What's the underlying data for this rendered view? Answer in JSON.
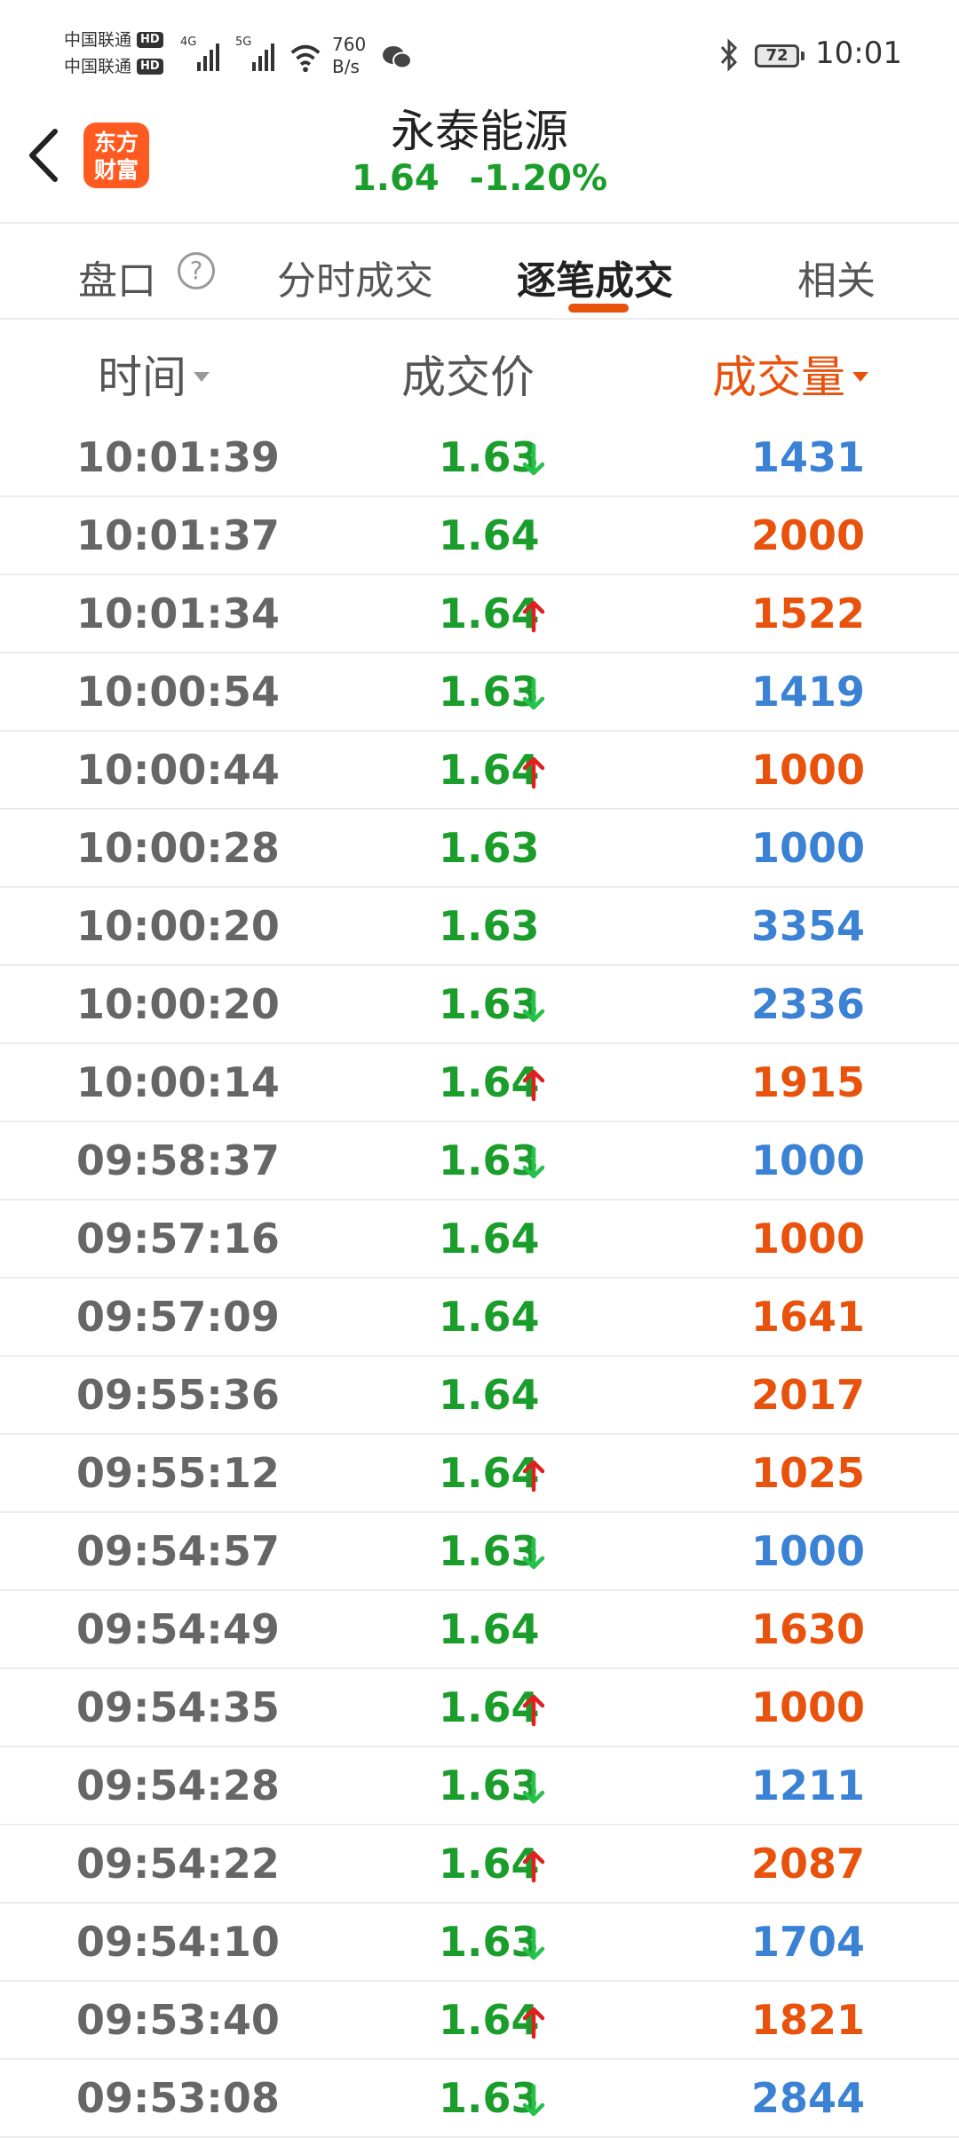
{
  "status_bar": {
    "carrier1": "中国联通",
    "carrier2": "中国联通",
    "hd_badge": "HD",
    "sig1": "4G",
    "sig2": "5G",
    "speed_value": "760",
    "speed_unit": "B/s",
    "battery": "72",
    "time": "10:01"
  },
  "header": {
    "app_logo_line1": "东方",
    "app_logo_line2": "财富",
    "title": "永泰能源",
    "price": "1.64",
    "change_pct": "-1.20%"
  },
  "tabs": [
    {
      "label": "盘口",
      "active": false
    },
    {
      "label": "分时成交",
      "active": false
    },
    {
      "label": "逐笔成交",
      "active": true
    },
    {
      "label": "相关",
      "active": false
    }
  ],
  "help_symbol": "?",
  "columns": {
    "time": "时间",
    "price": "成交价",
    "volume": "成交量",
    "sorted_by": "volume"
  },
  "colors": {
    "green": "#1a9d2b",
    "arrow_down": "#27c24c",
    "arrow_up": "#e02020",
    "orange": "#e8520c",
    "blue": "#3b82d4"
  },
  "trades": [
    {
      "time": "10:01:39",
      "price": "1.63",
      "dir": "down",
      "volume": "1431"
    },
    {
      "time": "10:01:37",
      "price": "1.64",
      "dir": "",
      "volume": "2000"
    },
    {
      "time": "10:01:34",
      "price": "1.64",
      "dir": "up",
      "volume": "1522"
    },
    {
      "time": "10:00:54",
      "price": "1.63",
      "dir": "down",
      "volume": "1419"
    },
    {
      "time": "10:00:44",
      "price": "1.64",
      "dir": "up",
      "volume": "1000"
    },
    {
      "time": "10:00:28",
      "price": "1.63",
      "dir": "",
      "volume": "1000"
    },
    {
      "time": "10:00:20",
      "price": "1.63",
      "dir": "",
      "volume": "3354"
    },
    {
      "time": "10:00:20",
      "price": "1.63",
      "dir": "down",
      "volume": "2336"
    },
    {
      "time": "10:00:14",
      "price": "1.64",
      "dir": "up",
      "volume": "1915"
    },
    {
      "time": "09:58:37",
      "price": "1.63",
      "dir": "down",
      "volume": "1000"
    },
    {
      "time": "09:57:16",
      "price": "1.64",
      "dir": "",
      "volume": "1000"
    },
    {
      "time": "09:57:09",
      "price": "1.64",
      "dir": "",
      "volume": "1641"
    },
    {
      "time": "09:55:36",
      "price": "1.64",
      "dir": "",
      "volume": "2017"
    },
    {
      "time": "09:55:12",
      "price": "1.64",
      "dir": "up",
      "volume": "1025"
    },
    {
      "time": "09:54:57",
      "price": "1.63",
      "dir": "down",
      "volume": "1000"
    },
    {
      "time": "09:54:49",
      "price": "1.64",
      "dir": "",
      "volume": "1630"
    },
    {
      "time": "09:54:35",
      "price": "1.64",
      "dir": "up",
      "volume": "1000"
    },
    {
      "time": "09:54:28",
      "price": "1.63",
      "dir": "down",
      "volume": "1211"
    },
    {
      "time": "09:54:22",
      "price": "1.64",
      "dir": "up",
      "volume": "2087"
    },
    {
      "time": "09:54:10",
      "price": "1.63",
      "dir": "down",
      "volume": "1704"
    },
    {
      "time": "09:53:40",
      "price": "1.64",
      "dir": "up",
      "volume": "1821"
    },
    {
      "time": "09:53:08",
      "price": "1.63",
      "dir": "down",
      "volume": "2844"
    }
  ]
}
